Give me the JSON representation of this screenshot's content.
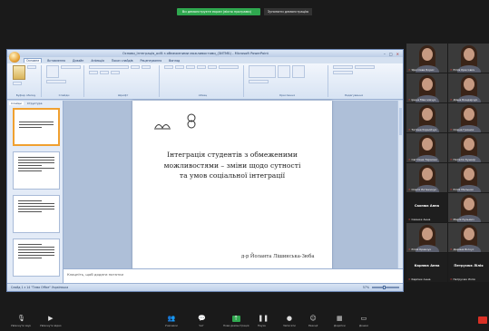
{
  "share_bar": {
    "notice": "Ви демонструєте екран (вікно програми)",
    "stop_label": "Зупинити демонстрацію"
  },
  "ppt": {
    "title": "Основи_Інтеграція_осіб з обмеженими можливостями_(ЗИТМБ) - Microsoft PowerPoint",
    "window_controls": [
      "–",
      "□",
      "✕"
    ],
    "tabs": [
      "Основне",
      "Вставлення",
      "Дизайн",
      "Анімація",
      "Показ слайдів",
      "Рецензування",
      "Вигляд"
    ],
    "ribbon_groups": [
      "Буфер обміну",
      "Слайди",
      "Шрифт",
      "Абзац",
      "Креслення",
      "Редагування"
    ],
    "pane_tabs": [
      "Слайди",
      "Структура"
    ],
    "slide_numbers": [
      "1",
      "2",
      "3",
      "4"
    ],
    "slide": {
      "title": "Інтеграція студентів з обмеженими можливостями – зміни щодо сутності та умов соціальної інтеграції",
      "author": "д-р Йоланта Лішинська-Зюбa"
    },
    "notes_placeholder": "Клацніть, щоб додати нотатки",
    "status_left": "Слайд 1 з 14   \"Тема Office\"   Українська",
    "zoom_level": "57%"
  },
  "gallery": {
    "participants": [
      {
        "name": "Ярослава Борис"
      },
      {
        "name": "Юлія Крисович"
      },
      {
        "name": "Ірина Максимчук"
      },
      {
        "name": "Діана Бондарчук"
      },
      {
        "name": "Тетяна Корнійчук"
      },
      {
        "name": "Олена Гринюк"
      },
      {
        "name": "Світлана Тарасюк"
      },
      {
        "name": "Наталія Кушнір"
      },
      {
        "name": "Олеся Литвинчук"
      },
      {
        "name": "Юлія Мельник"
      },
      {
        "name": "Сахнюк Анна"
      },
      {
        "name": "Марія Кузьмич"
      },
      {
        "name": "Юлія Кравчук"
      },
      {
        "name": "Дарина Білоус"
      },
      {
        "name": "Карпюк Анна"
      },
      {
        "name": "Петрусюк Лілія"
      }
    ],
    "name_cards": [
      "Сахнюк Анна",
      "Карпюк Анна",
      "Петрусюк Лілія"
    ]
  },
  "toolbar": {
    "items": [
      {
        "label": "Увімкнути звук",
        "icon": "microphone-icon"
      },
      {
        "label": "Зупинити відео",
        "icon": "video-camera-icon"
      },
      {
        "label": "Учасники",
        "icon": "participants-icon"
      },
      {
        "label": "Чат",
        "icon": "chat-icon"
      },
      {
        "label": "Нова демонстрація",
        "icon": "share-screen-icon"
      },
      {
        "label": "Пауза",
        "icon": "pause-icon"
      },
      {
        "label": "Записати",
        "icon": "record-icon"
      },
      {
        "label": "Реакції",
        "icon": "reactions-icon"
      },
      {
        "label": "Додатки",
        "icon": "apps-icon"
      },
      {
        "label": "Дошки",
        "icon": "whiteboard-icon"
      }
    ],
    "left_items": [
      {
        "label": "Увімкнути звук",
        "icon": "microphone-icon"
      },
      {
        "label": "Увімкнути відео",
        "icon": "video-camera-icon"
      }
    ]
  }
}
